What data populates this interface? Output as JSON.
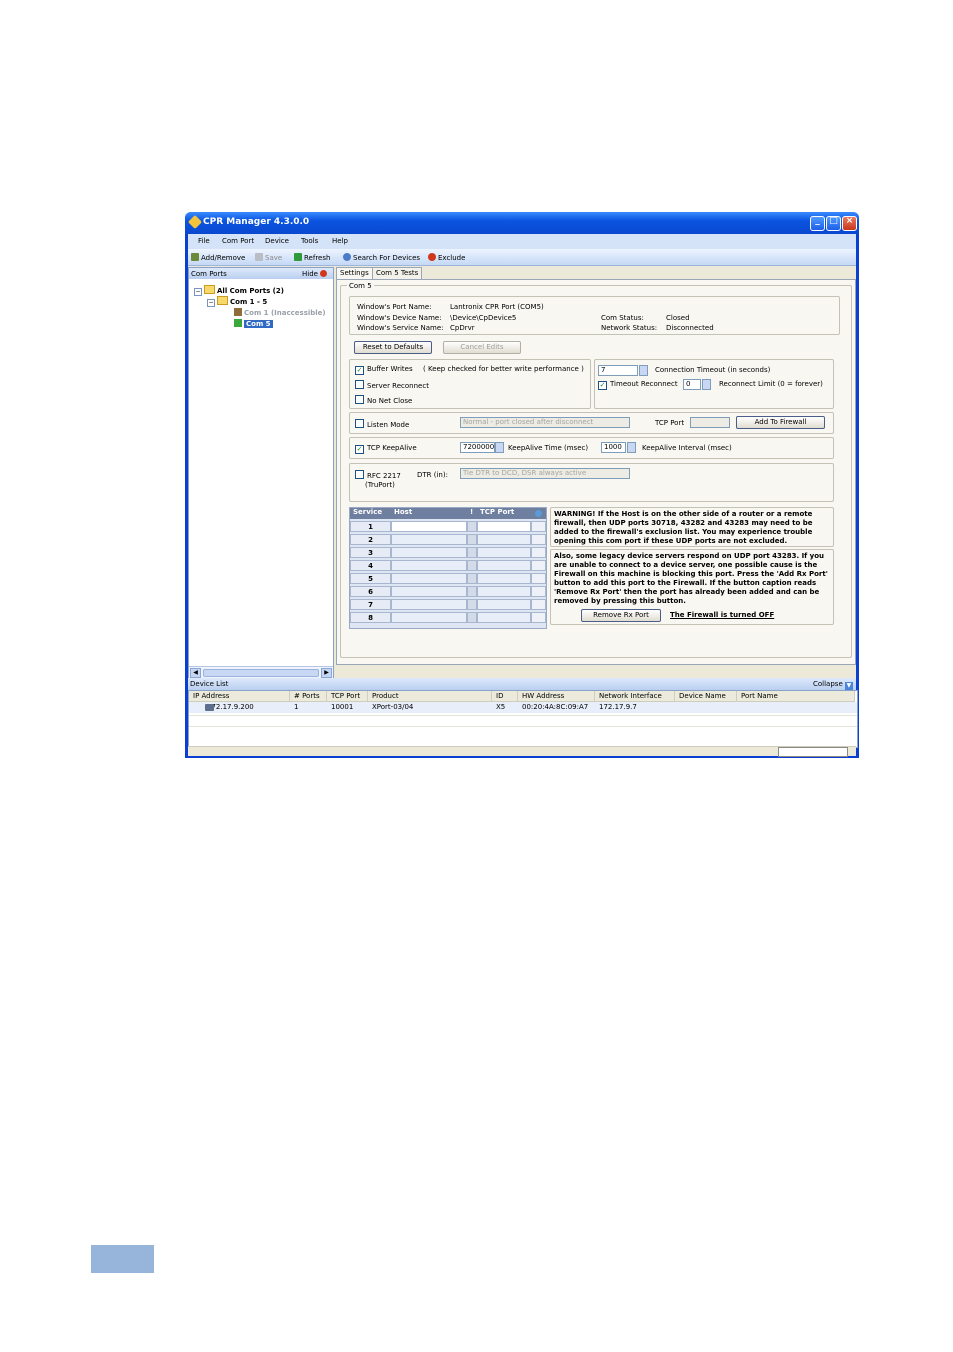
{
  "window": {
    "title": "CPR Manager 4.3.0.0"
  },
  "menu": [
    "File",
    "Com Port",
    "Device",
    "Tools",
    "Help"
  ],
  "toolbar": {
    "add_remove": "Add/Remove",
    "save": "Save",
    "refresh": "Refresh",
    "search": "Search For Devices",
    "exclude": "Exclude"
  },
  "left_pane": {
    "title": "Com Ports",
    "hide": "Hide",
    "tree": {
      "root": "All Com Ports (2)",
      "group": "Com 1 - 5",
      "item1": "Com 1 (Inaccessible)",
      "item2": "Com 5"
    }
  },
  "tabs": [
    "Settings",
    "Com 5 Tests"
  ],
  "settings": {
    "group_title": "Com 5",
    "port_name_label": "Window's Port Name:",
    "port_name": "Lantronix CPR Port (COM5)",
    "device_name_label": "Window's Device Name:",
    "device_name": "\\Device\\CpDevice5",
    "service_name_label": "Window's Service Name:",
    "service_name": "CpDrvr",
    "com_status_label": "Com Status:",
    "com_status": "Closed",
    "network_status_label": "Network Status:",
    "network_status": "Disconnected",
    "reset_btn": "Reset to Defaults",
    "cancel_btn": "Cancel Edits",
    "buffer_writes": "Buffer Writes",
    "buffer_note": "( Keep checked for better write performance )",
    "server_reconnect": "Server Reconnect",
    "no_net_close": "No Net Close",
    "conn_timeout_value": "7",
    "conn_timeout_label": "Connection Timeout (in seconds)",
    "timeout_reconnect": "Timeout Reconnect",
    "reconnect_limit_value": "0",
    "reconnect_limit_label": "Reconnect Limit (0 = forever)",
    "listen_mode": "Listen Mode",
    "listen_select": "Normal - port closed after disconnect",
    "tcp_port_label": "TCP Port",
    "add_firewall_btn": "Add To Firewall",
    "tcp_keepalive": "TCP KeepAlive",
    "keepalive_time_value": "7200000",
    "keepalive_time_label": "KeepAlive Time (msec)",
    "keepalive_interval_value": "1000",
    "keepalive_interval_label": "KeepAlive Interval (msec)",
    "rfc_label": "RFC 2217",
    "rfc_sub": "(TruPort)",
    "dtr_label": "DTR (in):",
    "dtr_select": "Tie DTR to DCD, DSR always active",
    "grid_headers": {
      "service": "Service",
      "host": "Host",
      "excl": "!",
      "tcp_port": "TCP Port"
    },
    "grid_rows": [
      "1",
      "2",
      "3",
      "4",
      "5",
      "6",
      "7",
      "8"
    ],
    "warning1": "WARNING!  If the Host is on the other side of a router or a remote firewall, then UDP ports 30718, 43282 and 43283 may need to be added to the firewall's exclusion list.  You may experience trouble opening this com port if these UDP ports are not excluded.",
    "warning2": "Also, some legacy device servers respond on UDP port 43283.  If you are unable to connect to a device server, one possible cause is the Firewall on this machine is blocking this port.  Press the 'Add Rx Port' button to add this port to the Firewall.   If the button caption reads 'Remove Rx Port' then the port has already been added and can be removed by pressing this button.",
    "remove_rx_btn": "Remove Rx Port",
    "firewall_status": "The Firewall is turned OFF"
  },
  "device_list": {
    "title": "Device List",
    "collapse": "Collapse",
    "headers": [
      "IP Address",
      "# Ports",
      "TCP Port",
      "Product",
      "ID",
      "HW Address",
      "Network Interface",
      "Device Name",
      "Port Name"
    ],
    "rows": [
      {
        "ip": "172.17.9.200",
        "ports": "1",
        "tcp": "10001",
        "product": "XPort-03/04",
        "id": "X5",
        "hw": "00:20:4A:8C:09:A7",
        "iface": "172.17.9.7",
        "dev": "",
        "port": ""
      }
    ]
  },
  "colors": {
    "titlebar": "#0a48cf",
    "menubar": "#d5e3f8",
    "page_tab": "#97b4db"
  }
}
